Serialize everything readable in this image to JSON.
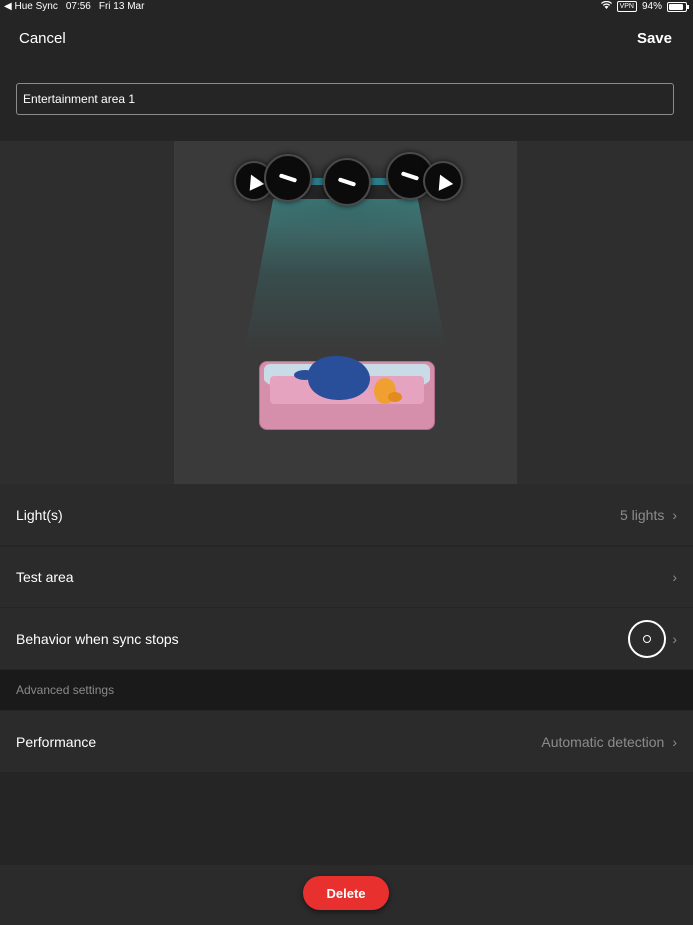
{
  "status_bar": {
    "back_app": "◀ Hue Sync",
    "time": "07:56",
    "date": "Fri 13 Mar",
    "vpn": "VPN",
    "battery": "94%"
  },
  "nav": {
    "cancel_label": "Cancel",
    "save_label": "Save"
  },
  "area_name": {
    "value": "Entertainment area 1"
  },
  "preview": {
    "light_count": 5,
    "beam_color": "#408c8c"
  },
  "rows": {
    "lights": {
      "label": "Light(s)",
      "value": "5 lights",
      "chevron": "›"
    },
    "test_area": {
      "label": "Test area",
      "chevron": "›"
    },
    "behavior": {
      "label": "Behavior when sync stops",
      "chevron": "›"
    }
  },
  "advanced": {
    "header": "Advanced settings",
    "performance": {
      "label": "Performance",
      "value": "Automatic detection",
      "chevron": "›"
    }
  },
  "footer": {
    "delete_label": "Delete",
    "delete_color": "#e8302f"
  },
  "icons": [
    "wifi-icon",
    "battery-icon",
    "chevron-right-icon",
    "light-bar-icon",
    "light-cone-icon",
    "sync-ring-icon"
  ]
}
